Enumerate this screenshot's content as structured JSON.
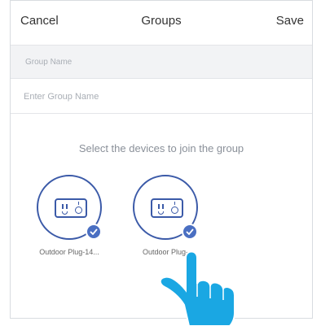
{
  "navbar": {
    "cancel_label": "Cancel",
    "title": "Groups",
    "save_label": "Save"
  },
  "group_name": {
    "section_label": "Group Name",
    "placeholder": "Enter Group Name",
    "value": ""
  },
  "instruction": "Select the devices to join the group",
  "devices": [
    {
      "name": "Outdoor Plug-14...",
      "icon": "outdoor-plug-icon",
      "selected": true
    },
    {
      "name": "Outdoor Plug-",
      "icon": "outdoor-plug-icon",
      "selected": true
    }
  ],
  "colors": {
    "accent": "#3b5aa8",
    "check": "#4a6fc2",
    "hand": "#1aa7e3"
  }
}
